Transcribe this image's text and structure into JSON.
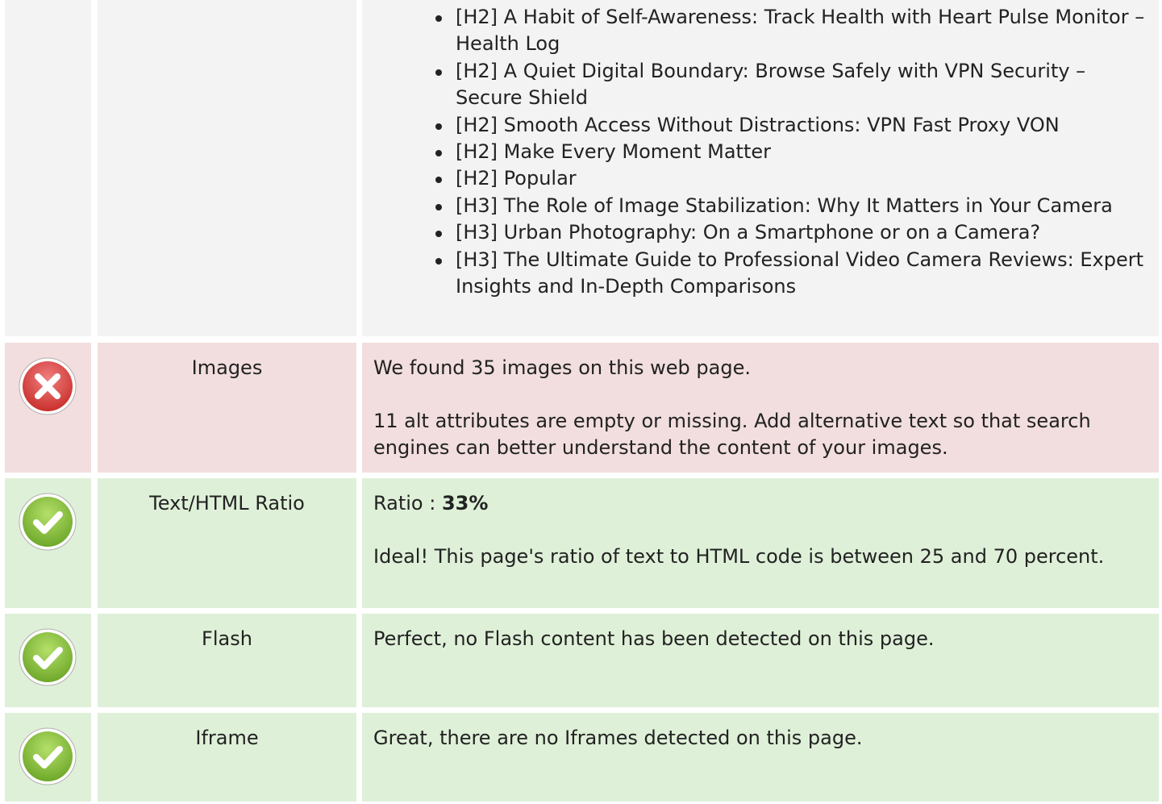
{
  "heading_list": [
    "[H2] A Habit of Self-Awareness: Track Health with Heart Pulse Monitor – Health Log",
    "[H2] A Quiet Digital Boundary: Browse Safely with VPN Security – Secure Shield",
    "[H2] Smooth Access Without Distractions: VPN Fast Proxy VON",
    "[H2] Make Every Moment Matter",
    "[H2] Popular",
    "[H3] The Role of Image Stabilization: Why It Matters in Your Camera",
    "[H3] Urban Photography: On a Smartphone or on a Camera?",
    "[H3] The Ultimate Guide to Professional Video Camera Reviews: Expert Insights and In-Depth Comparisons"
  ],
  "images": {
    "status": "error",
    "status_icon": "cross-icon",
    "label": "Images",
    "line1": "We found 35 images on this web page.",
    "line2": "11 alt attributes are empty or missing. Add alternative text so that search engines can better understand the content of your images."
  },
  "ratio": {
    "status": "good",
    "status_icon": "check-icon",
    "label": "Text/HTML Ratio",
    "ratio_prefix": "Ratio : ",
    "ratio_value": "33%",
    "line2": "Ideal! This page's ratio of text to HTML code is between 25 and 70 percent."
  },
  "flash": {
    "status": "good",
    "status_icon": "check-icon",
    "label": "Flash",
    "line1": "Perfect, no Flash content has been detected on this page."
  },
  "iframe": {
    "status": "good",
    "status_icon": "check-icon",
    "label": "Iframe",
    "line1": "Great, there are no Iframes detected on this page."
  },
  "colors": {
    "error_bg": "#f2dede",
    "good_bg": "#dff0d8",
    "neutral_bg": "#f3f3f3",
    "error_icon": "#d9534f",
    "good_icon": "#8cc63f"
  }
}
